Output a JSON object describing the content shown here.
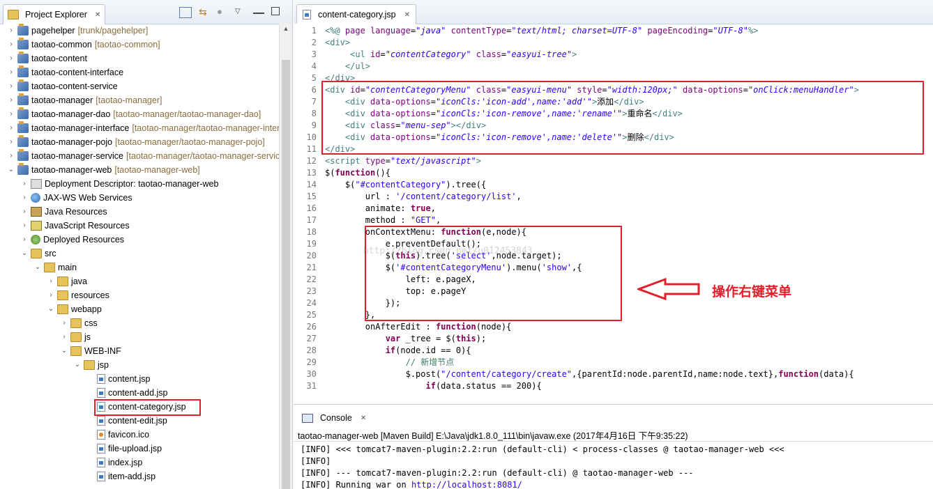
{
  "explorer": {
    "tab_title": "Project Explorer",
    "close_glyph": "✕",
    "items": [
      {
        "label": "pagehelper",
        "decor": "[trunk/pagehelper]",
        "icon": "project-icon",
        "depth": 0,
        "arrow": "›"
      },
      {
        "label": "taotao-common",
        "decor": "[taotao-common]",
        "icon": "project-icon",
        "depth": 0,
        "arrow": "›"
      },
      {
        "label": "taotao-content",
        "decor": "",
        "icon": "project-icon",
        "depth": 0,
        "arrow": "›"
      },
      {
        "label": "taotao-content-interface",
        "decor": "",
        "icon": "project-icon",
        "depth": 0,
        "arrow": "›"
      },
      {
        "label": "taotao-content-service",
        "decor": "",
        "icon": "project-icon",
        "depth": 0,
        "arrow": "›"
      },
      {
        "label": "taotao-manager",
        "decor": "[taotao-manager]",
        "icon": "project-icon",
        "depth": 0,
        "arrow": "›"
      },
      {
        "label": "taotao-manager-dao",
        "decor": "[taotao-manager/taotao-manager-dao]",
        "icon": "project-icon",
        "depth": 0,
        "arrow": "›"
      },
      {
        "label": "taotao-manager-interface",
        "decor": "[taotao-manager/taotao-manager-interface]",
        "icon": "project-icon",
        "depth": 0,
        "arrow": "›"
      },
      {
        "label": "taotao-manager-pojo",
        "decor": "[taotao-manager/taotao-manager-pojo]",
        "icon": "project-icon",
        "depth": 0,
        "arrow": "›"
      },
      {
        "label": "taotao-manager-service",
        "decor": "[taotao-manager/taotao-manager-service]",
        "icon": "project-icon",
        "depth": 0,
        "arrow": "›"
      },
      {
        "label": "taotao-manager-web",
        "decor": "[taotao-manager-web]",
        "icon": "project-icon",
        "depth": 0,
        "arrow": "⌄"
      },
      {
        "label": "Deployment Descriptor: taotao-manager-web",
        "decor": "",
        "icon": "descriptor-icon",
        "depth": 1,
        "arrow": "›"
      },
      {
        "label": "JAX-WS Web Services",
        "decor": "",
        "icon": "webservices-icon",
        "depth": 1,
        "arrow": "›"
      },
      {
        "label": "Java Resources",
        "decor": "",
        "icon": "java-resources-icon",
        "depth": 1,
        "arrow": "›"
      },
      {
        "label": "JavaScript Resources",
        "decor": "",
        "icon": "javascript-resources-icon",
        "depth": 1,
        "arrow": "›"
      },
      {
        "label": "Deployed Resources",
        "decor": "",
        "icon": "deployed-resources-icon",
        "depth": 1,
        "arrow": "›"
      },
      {
        "label": "src",
        "decor": "",
        "icon": "folder-icon",
        "depth": 1,
        "arrow": "⌄"
      },
      {
        "label": "main",
        "decor": "",
        "icon": "folder-icon",
        "depth": 2,
        "arrow": "⌄"
      },
      {
        "label": "java",
        "decor": "",
        "icon": "folder-icon",
        "depth": 3,
        "arrow": "›"
      },
      {
        "label": "resources",
        "decor": "",
        "icon": "folder-icon",
        "depth": 3,
        "arrow": "›"
      },
      {
        "label": "webapp",
        "decor": "",
        "icon": "folder-icon",
        "depth": 3,
        "arrow": "⌄"
      },
      {
        "label": "css",
        "decor": "",
        "icon": "folder-icon",
        "depth": 4,
        "arrow": "›"
      },
      {
        "label": "js",
        "decor": "",
        "icon": "folder-icon",
        "depth": 4,
        "arrow": "›"
      },
      {
        "label": "WEB-INF",
        "decor": "",
        "icon": "folder-icon",
        "depth": 4,
        "arrow": "⌄"
      },
      {
        "label": "jsp",
        "decor": "",
        "icon": "folder-icon",
        "depth": 5,
        "arrow": "⌄"
      },
      {
        "label": "content.jsp",
        "decor": "",
        "icon": "jsp-file-icon",
        "depth": 6,
        "arrow": ""
      },
      {
        "label": "content-add.jsp",
        "decor": "",
        "icon": "jsp-file-icon",
        "depth": 6,
        "arrow": ""
      },
      {
        "label": "content-category.jsp",
        "decor": "",
        "icon": "jsp-file-icon",
        "depth": 6,
        "arrow": "",
        "highlight": true
      },
      {
        "label": "content-edit.jsp",
        "decor": "",
        "icon": "jsp-file-icon",
        "depth": 6,
        "arrow": ""
      },
      {
        "label": "favicon.ico",
        "decor": "",
        "icon": "ico-file-icon",
        "depth": 6,
        "arrow": ""
      },
      {
        "label": "file-upload.jsp",
        "decor": "",
        "icon": "jsp-file-icon",
        "depth": 6,
        "arrow": ""
      },
      {
        "label": "index.jsp",
        "decor": "",
        "icon": "jsp-file-icon",
        "depth": 6,
        "arrow": ""
      },
      {
        "label": "item-add.jsp",
        "decor": "",
        "icon": "jsp-file-icon",
        "depth": 6,
        "arrow": ""
      }
    ]
  },
  "editor": {
    "tab_title": "content-category.jsp",
    "close_glyph": "✕",
    "lines": [
      {
        "n": "1",
        "segs": [
          [
            "tag",
            "<%@ "
          ],
          [
            "attr",
            "page language"
          ],
          [
            "",
            "="
          ],
          [
            "str",
            "\"java\""
          ],
          [
            "attr",
            " contentType"
          ],
          [
            "",
            "="
          ],
          [
            "str",
            "\"text/html; charset=UTF-8\""
          ],
          [
            "attr",
            " pageEncoding"
          ],
          [
            "",
            "="
          ],
          [
            "str",
            "\"UTF-8\""
          ],
          [
            "tag",
            "%>"
          ]
        ]
      },
      {
        "n": "2",
        "segs": [
          [
            "tag",
            "<div>"
          ]
        ]
      },
      {
        "n": "3",
        "segs": [
          [
            "",
            "     "
          ],
          [
            "tag",
            "<ul "
          ],
          [
            "attr",
            "id"
          ],
          [
            "",
            "="
          ],
          [
            "str",
            "\"contentCategory\""
          ],
          [
            "attr",
            " class"
          ],
          [
            "",
            "="
          ],
          [
            "str",
            "\"easyui-tree\""
          ],
          [
            "tag",
            ">"
          ]
        ]
      },
      {
        "n": "4",
        "segs": [
          [
            "",
            "    "
          ],
          [
            "tag",
            "</ul>"
          ]
        ]
      },
      {
        "n": "5",
        "segs": [
          [
            "tag",
            "</div>"
          ]
        ]
      },
      {
        "n": "6",
        "segs": [
          [
            "tag",
            "<div "
          ],
          [
            "attr",
            "id"
          ],
          [
            "",
            "="
          ],
          [
            "str",
            "\"contentCategoryMenu\""
          ],
          [
            "attr",
            " class"
          ],
          [
            "",
            "="
          ],
          [
            "str",
            "\"easyui-menu\""
          ],
          [
            "attr",
            " style"
          ],
          [
            "",
            "="
          ],
          [
            "str",
            "\"width:120px;\""
          ],
          [
            "attr",
            " data-options"
          ],
          [
            "",
            "="
          ],
          [
            "str",
            "\"onClick:menuHandler\""
          ],
          [
            "tag",
            ">"
          ]
        ]
      },
      {
        "n": "7",
        "segs": [
          [
            "",
            "    "
          ],
          [
            "tag",
            "<div "
          ],
          [
            "attr",
            "data-options"
          ],
          [
            "",
            "="
          ],
          [
            "str",
            "\"iconCls:'icon-add',name:'add'\""
          ],
          [
            "tag",
            ">"
          ],
          [
            "cn",
            "添加"
          ],
          [
            "tag",
            "</div>"
          ]
        ]
      },
      {
        "n": "8",
        "segs": [
          [
            "",
            "    "
          ],
          [
            "tag",
            "<div "
          ],
          [
            "attr",
            "data-options"
          ],
          [
            "",
            "="
          ],
          [
            "str",
            "\"iconCls:'icon-remove',name:'rename'\""
          ],
          [
            "tag",
            ">"
          ],
          [
            "cn",
            "重命名"
          ],
          [
            "tag",
            "</div>"
          ]
        ]
      },
      {
        "n": "9",
        "segs": [
          [
            "",
            "    "
          ],
          [
            "tag",
            "<div "
          ],
          [
            "attr",
            "class"
          ],
          [
            "",
            "="
          ],
          [
            "str",
            "\"menu-sep\""
          ],
          [
            "tag",
            "></div>"
          ]
        ]
      },
      {
        "n": "10",
        "segs": [
          [
            "",
            "    "
          ],
          [
            "tag",
            "<div "
          ],
          [
            "attr",
            "data-options"
          ],
          [
            "",
            "="
          ],
          [
            "str",
            "\"iconCls:'icon-remove',name:'delete'\""
          ],
          [
            "tag",
            ">"
          ],
          [
            "cn",
            "删除"
          ],
          [
            "tag",
            "</div>"
          ]
        ]
      },
      {
        "n": "11",
        "segs": [
          [
            "tag",
            "</div>"
          ]
        ]
      },
      {
        "n": "12",
        "segs": [
          [
            "tag",
            "<script "
          ],
          [
            "attr",
            "type"
          ],
          [
            "",
            "="
          ],
          [
            "str",
            "\"text/javascript\""
          ],
          [
            "tag",
            ">"
          ]
        ]
      },
      {
        "n": "13",
        "segs": [
          [
            "",
            "$("
          ],
          [
            "kw",
            "function"
          ],
          [
            "",
            "(){"
          ]
        ]
      },
      {
        "n": "14",
        "segs": [
          [
            "",
            "    $("
          ],
          [
            "jstr",
            "\"#contentCategory\""
          ],
          [
            "",
            ").tree({"
          ]
        ]
      },
      {
        "n": "15",
        "segs": [
          [
            "",
            "        url : "
          ],
          [
            "jstr",
            "'/content/category/list'"
          ],
          [
            "",
            ","
          ]
        ]
      },
      {
        "n": "16",
        "segs": [
          [
            "",
            "        animate: "
          ],
          [
            "kw",
            "true"
          ],
          [
            "",
            ","
          ]
        ]
      },
      {
        "n": "17",
        "segs": [
          [
            "",
            "        method : "
          ],
          [
            "jstr",
            "\"GET\""
          ],
          [
            "",
            ","
          ]
        ]
      },
      {
        "n": "18",
        "segs": [
          [
            "",
            "        onContextMenu: "
          ],
          [
            "kw",
            "function"
          ],
          [
            "",
            "(e,node){"
          ]
        ]
      },
      {
        "n": "19",
        "segs": [
          [
            "",
            "            e.preventDefault();"
          ]
        ]
      },
      {
        "n": "20",
        "segs": [
          [
            "",
            "            $("
          ],
          [
            "kw",
            "this"
          ],
          [
            "",
            ").tree("
          ],
          [
            "jstr",
            "'select'"
          ],
          [
            "",
            ",node.target);"
          ]
        ]
      },
      {
        "n": "21",
        "segs": [
          [
            "",
            "            $("
          ],
          [
            "jstr",
            "'#contentCategoryMenu'"
          ],
          [
            "",
            ").menu("
          ],
          [
            "jstr",
            "'show'"
          ],
          [
            "",
            ",{"
          ]
        ]
      },
      {
        "n": "22",
        "segs": [
          [
            "",
            "                left: e.pageX,"
          ]
        ]
      },
      {
        "n": "23",
        "segs": [
          [
            "",
            "                top: e.pageY"
          ]
        ]
      },
      {
        "n": "24",
        "segs": [
          [
            "",
            "            });"
          ]
        ]
      },
      {
        "n": "25",
        "segs": [
          [
            "",
            "        },"
          ]
        ]
      },
      {
        "n": "26",
        "segs": [
          [
            "",
            "        onAfterEdit : "
          ],
          [
            "kw",
            "function"
          ],
          [
            "",
            "(node){"
          ]
        ]
      },
      {
        "n": "27",
        "segs": [
          [
            "",
            "            "
          ],
          [
            "kw",
            "var"
          ],
          [
            "",
            " _tree = $("
          ],
          [
            "kw",
            "this"
          ],
          [
            "",
            ");"
          ]
        ]
      },
      {
        "n": "28",
        "segs": [
          [
            "",
            "            "
          ],
          [
            "kw",
            "if"
          ],
          [
            "",
            "(node.id == 0){"
          ]
        ]
      },
      {
        "n": "29",
        "segs": [
          [
            "",
            "                "
          ],
          [
            "cmt",
            "// "
          ],
          [
            "cmt",
            "新增节点"
          ]
        ]
      },
      {
        "n": "30",
        "segs": [
          [
            "",
            "                $.post("
          ],
          [
            "jstr",
            "\"/content/category/create\""
          ],
          [
            "",
            ",{parentId:node.parentId,name:node.text},"
          ],
          [
            "kw",
            "function"
          ],
          [
            "",
            "(data){"
          ]
        ]
      },
      {
        "n": "31",
        "segs": [
          [
            "",
            "                    "
          ],
          [
            "kw",
            "if"
          ],
          [
            "",
            "(data.status == 200){"
          ]
        ]
      }
    ],
    "watermark": "http://blog.csdn.net/u012453843",
    "annotation": "操作右键菜单",
    "accent": "#e0202a"
  },
  "console": {
    "tab_title": "Console",
    "close_glyph": "✕",
    "description": "taotao-manager-web [Maven Build] E:\\Java\\jdk1.8.0_111\\bin\\javaw.exe (2017年4月16日 下午9:35:22)",
    "lines": [
      {
        "text": "[INFO] <<< tomcat7-maven-plugin:2.2:run (default-cli) < process-classes @ taotao-manager-web <<<",
        "link": ""
      },
      {
        "text": "[INFO]",
        "link": ""
      },
      {
        "text": "[INFO] --- tomcat7-maven-plugin:2.2:run (default-cli) @ taotao-manager-web ---",
        "link": ""
      },
      {
        "text": "[INFO] Running war on ",
        "link": "http://localhost:8081/"
      }
    ]
  }
}
